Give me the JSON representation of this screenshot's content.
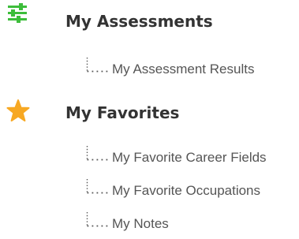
{
  "icons": {
    "assessments": "sliders-icon",
    "favorites": "star-icon"
  },
  "colors": {
    "assessments_icon": "#3dbd3b",
    "favorites_icon": "#f7a823",
    "title_text": "#333333",
    "item_text": "#555555",
    "connector": "#555555"
  },
  "sections": [
    {
      "title": "My Assessments",
      "items": [
        {
          "label": "My Assessment Results"
        }
      ]
    },
    {
      "title": "My Favorites",
      "items": [
        {
          "label": "My Favorite Career Fields"
        },
        {
          "label": "My Favorite Occupations"
        },
        {
          "label": "My Notes"
        }
      ]
    }
  ]
}
